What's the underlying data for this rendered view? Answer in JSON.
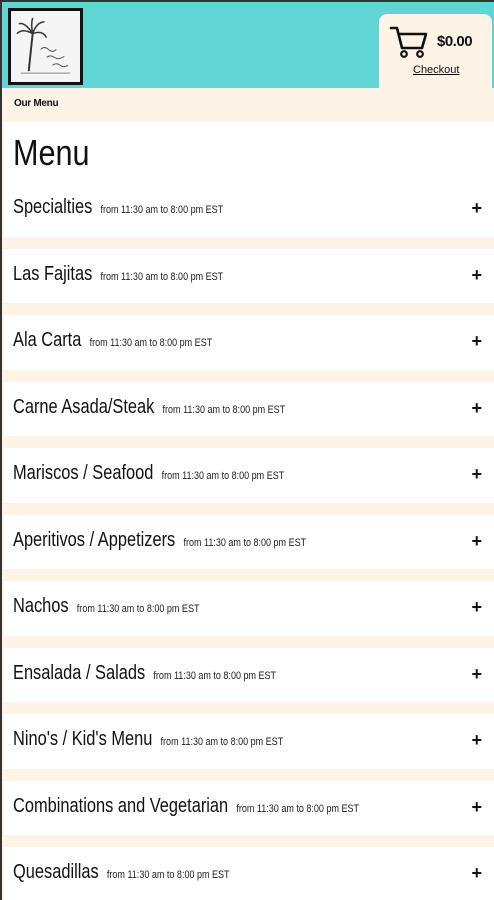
{
  "header": {
    "logo_alt": "La Palma Azul",
    "cart_total": "$0.00",
    "checkout_label": "Checkout",
    "accent_color": "#5fd6d5",
    "background_color": "#fdf3e6"
  },
  "breadcrumb": {
    "label": "Our Menu"
  },
  "main": {
    "title": "Menu",
    "categories": [
      {
        "name": "Specialties",
        "hours": "from 11:30 am to 8:00 pm EST"
      },
      {
        "name": "Las Fajitas",
        "hours": "from 11:30 am to 8:00 pm EST"
      },
      {
        "name": "Ala Carta",
        "hours": "from 11:30 am to 8:00 pm EST"
      },
      {
        "name": "Carne Asada/Steak",
        "hours": "from 11:30 am to 8:00 pm EST"
      },
      {
        "name": "Mariscos / Seafood",
        "hours": "from 11:30 am to 8:00 pm EST"
      },
      {
        "name": "Aperitivos / Appetizers",
        "hours": "from 11:30 am to 8:00 pm EST"
      },
      {
        "name": "Nachos",
        "hours": "from 11:30 am to 8:00 pm EST"
      },
      {
        "name": "Ensalada / Salads",
        "hours": "from 11:30 am to 8:00 pm EST"
      },
      {
        "name": "Nino's / Kid's Menu",
        "hours": "from 11:30 am to 8:00 pm EST"
      },
      {
        "name": "Combinations and Vegetarian",
        "hours": "from 11:30 am to 8:00 pm EST"
      },
      {
        "name": "Quesadillas",
        "hours": "from 11:30 am to 8:00 pm EST"
      }
    ],
    "expand_symbol": "+"
  }
}
